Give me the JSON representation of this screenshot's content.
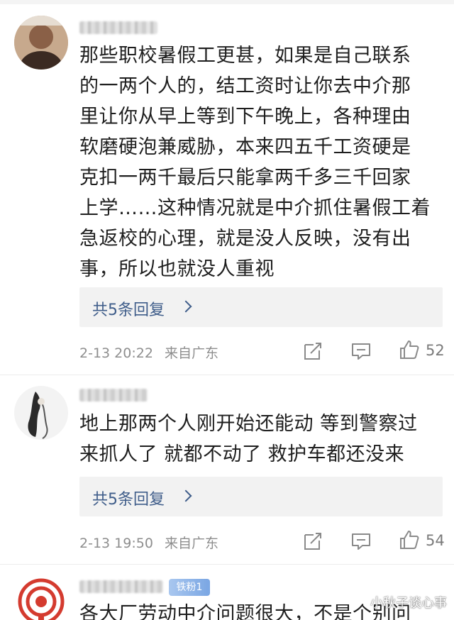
{
  "comments": [
    {
      "text": "那些职校暑假工更甚，如果是自己联系\n的一两个人的，结工资时让你去中介那\n里让你从早上等到下午晚上，各种理由\n软磨硬泡兼威胁，本来四五千工资硬是\n克扣一两千最后只能拿两千多三千回家\n上学……这种情况就是中介抓住暑假工着\n急返校的心理，就是没人反映，没有出\n事，所以也就没人重视",
      "reply_label": "共5条回复",
      "time": "2-13 20:22",
      "location": "来自广东",
      "likes": "52"
    },
    {
      "text": "地上那两个人刚开始还能动 等到警察过\n来抓人了 就都不动了 救护车都还没来",
      "reply_label": "共5条回复",
      "time": "2-13 19:50",
      "location": "来自广东",
      "likes": "54"
    },
    {
      "badge": "铁粉1",
      "text": "各大厂劳动中介问题很大，不是个别问"
    }
  ],
  "watermark": "小秋子谈心事",
  "colors": {
    "link": "#3f5d8a",
    "meta": "#8e8e8e",
    "reply_bg": "#f2f2f2",
    "badge": "#7aa6e3"
  },
  "icons": [
    "share-icon",
    "comment-icon",
    "like-icon"
  ]
}
